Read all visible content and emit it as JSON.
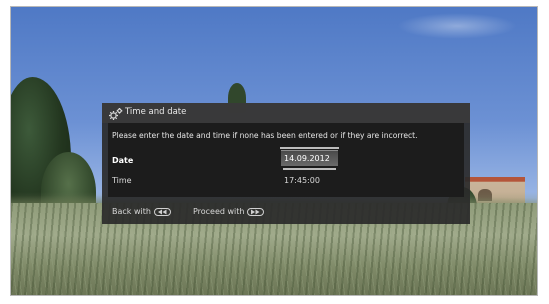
{
  "dialog": {
    "title": "Time and date",
    "icon": "gear-icon",
    "instruction": "Please enter the date and time if none has been entered or if they are incorrect.",
    "rows": [
      {
        "label": "Date",
        "value": "14.09.2012",
        "selected": true
      },
      {
        "label": "Time",
        "value": "17:45:00",
        "selected": false
      }
    ],
    "footer": {
      "back_label": "Back with",
      "back_icon": "rewind-key-icon",
      "proceed_label": "Proceed with",
      "proceed_icon": "fast-forward-key-icon"
    }
  }
}
